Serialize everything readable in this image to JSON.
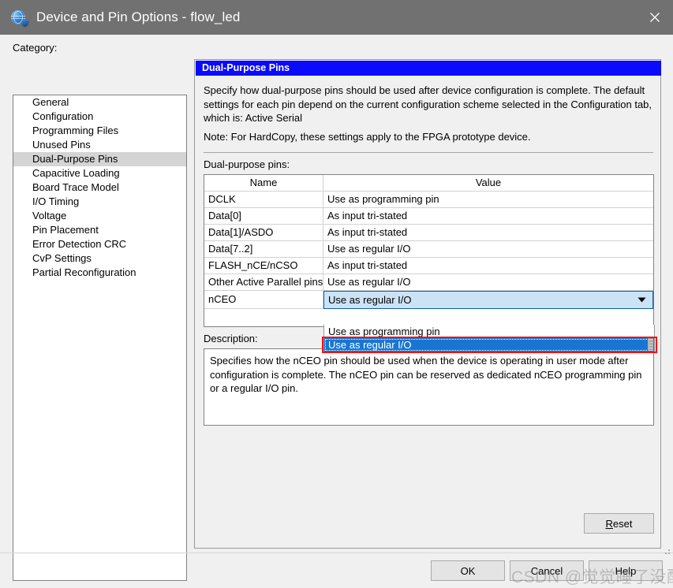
{
  "window": {
    "title": "Device and Pin Options - flow_led",
    "app_icon": "quartus-globe-icon",
    "close_icon": "close-icon"
  },
  "sidebar": {
    "label": "Category:",
    "items": [
      {
        "label": "General",
        "selected": false
      },
      {
        "label": "Configuration",
        "selected": false
      },
      {
        "label": "Programming Files",
        "selected": false
      },
      {
        "label": "Unused Pins",
        "selected": false
      },
      {
        "label": "Dual-Purpose Pins",
        "selected": true
      },
      {
        "label": "Capacitive Loading",
        "selected": false
      },
      {
        "label": "Board Trace Model",
        "selected": false
      },
      {
        "label": "I/O Timing",
        "selected": false
      },
      {
        "label": "Voltage",
        "selected": false
      },
      {
        "label": "Pin Placement",
        "selected": false
      },
      {
        "label": "Error Detection CRC",
        "selected": false
      },
      {
        "label": "CvP Settings",
        "selected": false
      },
      {
        "label": "Partial Reconfiguration",
        "selected": false
      }
    ]
  },
  "panel": {
    "header": "Dual-Purpose Pins",
    "intro": "Specify how dual-purpose pins should be used after device configuration is complete. The default settings for each pin depend on the current configuration scheme selected in the Configuration tab, which is:  Active Serial",
    "note": "Note: For HardCopy, these settings apply to the FPGA prototype device.",
    "pins_label": "Dual-purpose pins:",
    "table": {
      "columns": [
        "Name",
        "Value"
      ],
      "rows": [
        {
          "name": "DCLK",
          "value": "Use as programming pin"
        },
        {
          "name": "Data[0]",
          "value": "As input tri-stated"
        },
        {
          "name": "Data[1]/ASDO",
          "value": "As input tri-stated"
        },
        {
          "name": "Data[7..2]",
          "value": "Use as regular I/O"
        },
        {
          "name": "FLASH_nCE/nCSO",
          "value": "As input tri-stated"
        },
        {
          "name": "Other Active Parallel pins",
          "value": "Use as regular I/O"
        }
      ],
      "editing_row": {
        "name": "nCEO",
        "value": "Use as regular I/O",
        "arrow_icon": "chevron-down-icon"
      }
    },
    "dropdown": {
      "open": true,
      "options": [
        {
          "label": "Use as programming pin",
          "selected": false
        },
        {
          "label": "Use as regular I/O",
          "selected": true
        }
      ]
    },
    "description_label": "Description:",
    "description": "Specifies how the nCEO pin should be used when the device is operating in user mode after configuration is complete. The nCEO pin can be reserved as dedicated nCEO programming pin or a regular I/O pin.",
    "reset_label": "Reset",
    "reset_accel": "R"
  },
  "footer": {
    "ok_label": "OK",
    "cancel_label": "Cancel",
    "help_label": "Help"
  },
  "watermark": "CSDN @觉觉睡了没醒",
  "colors": {
    "titlebar": "#717171",
    "panel_header": "#0a0aff",
    "selection": "#1876d2",
    "combo_fill": "#cce3f6",
    "annotation": "#fb0f0f",
    "dialog_bg": "#f0f0f0"
  }
}
